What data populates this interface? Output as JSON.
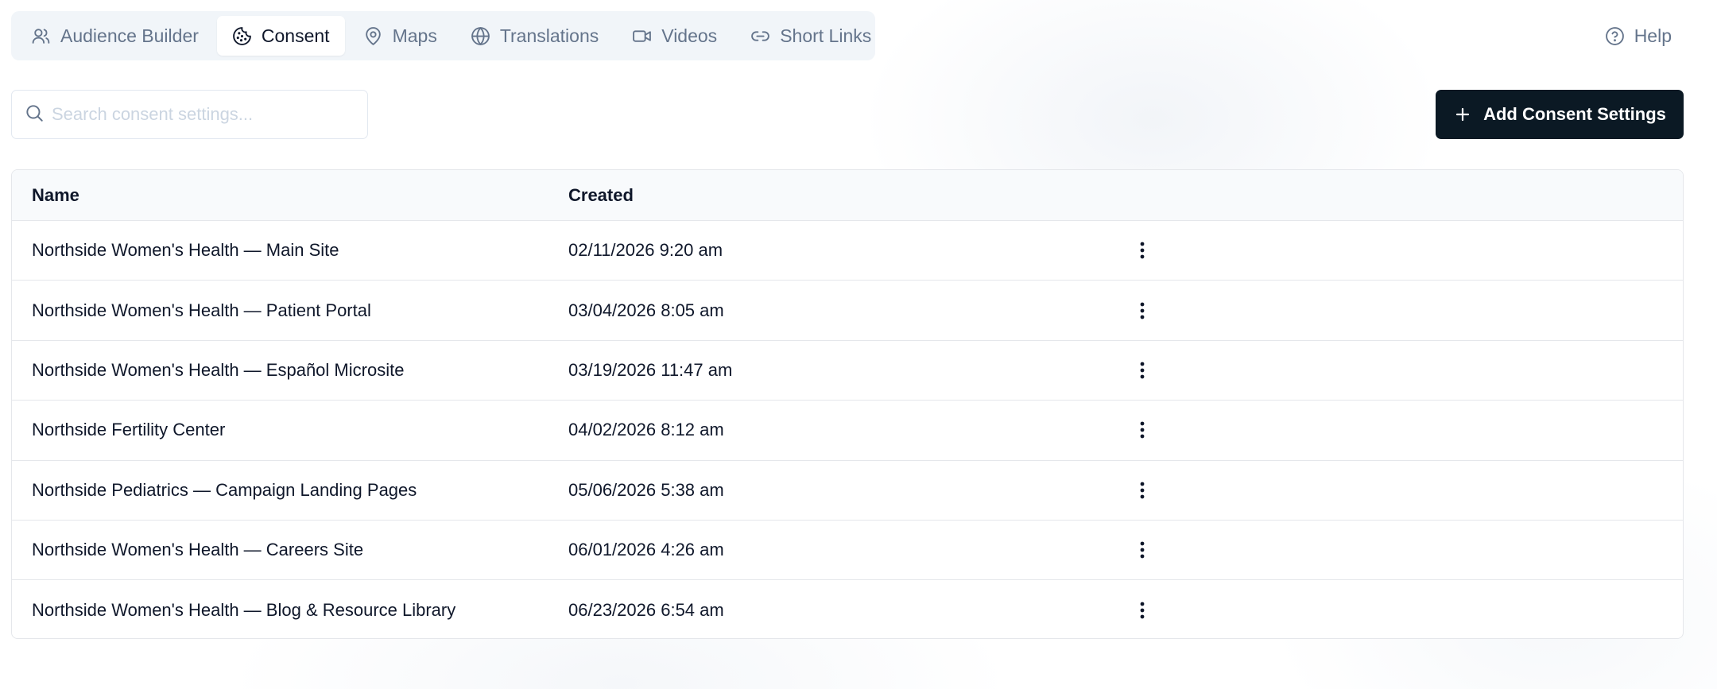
{
  "nav": {
    "tabs": [
      {
        "label": "Audience Builder",
        "icon": "users-icon",
        "active": false
      },
      {
        "label": "Consent",
        "icon": "cookie-icon",
        "active": true
      },
      {
        "label": "Maps",
        "icon": "map-pin-icon",
        "active": false
      },
      {
        "label": "Translations",
        "icon": "globe-icon",
        "active": false
      },
      {
        "label": "Videos",
        "icon": "video-icon",
        "active": false
      },
      {
        "label": "Short Links",
        "icon": "link-icon",
        "active": false
      }
    ],
    "help_label": "Help"
  },
  "toolbar": {
    "search_placeholder": "Search consent settings...",
    "search_value": "",
    "add_label": "Add Consent Settings"
  },
  "table": {
    "columns": [
      "Name",
      "Created"
    ],
    "rows": [
      {
        "name": "Northside Women's Health — Main Site",
        "created": "02/11/2026 9:20 am"
      },
      {
        "name": "Northside Women's Health — Patient Portal",
        "created": "03/04/2026 8:05 am"
      },
      {
        "name": "Northside Women's Health — Español Microsite",
        "created": "03/19/2026 11:47 am"
      },
      {
        "name": "Northside Fertility Center",
        "created": "04/02/2026 8:12 am"
      },
      {
        "name": "Northside Pediatrics — Campaign Landing Pages",
        "created": "05/06/2026 5:38 am"
      },
      {
        "name": "Northside Women's Health — Careers Site",
        "created": "06/01/2026 4:26 am"
      },
      {
        "name": "Northside Women's Health — Blog & Resource Library",
        "created": "06/23/2026 6:54 am"
      }
    ]
  },
  "colors": {
    "primary_button": "#0b1924",
    "tab_bar_bg": "#f1f5f9",
    "muted_text": "#64748b"
  }
}
